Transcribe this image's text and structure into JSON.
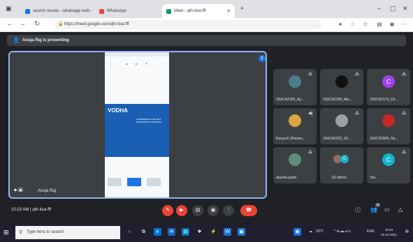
{
  "browser": {
    "tabs": [
      {
        "label": "search results - whatsapp web - ",
        "favicon_color": "#1a73e8"
      },
      {
        "label": "WhatsApp",
        "favicon_color": "#ea4335"
      },
      {
        "label": "Meet - qth-itoa-fff",
        "favicon_color": "#0f9d58"
      }
    ],
    "new_tab": "+",
    "window_controls": {
      "minimize": "–",
      "maximize": "▢",
      "close": "✕"
    },
    "url": "https://meet.google.com/qth-itoa-fff"
  },
  "presenting": {
    "text": "Anuja Raj is presenting"
  },
  "main_video": {
    "name": "Anuja Raj",
    "doc_logo": "VODHA",
    "doc_heading": "EXPERIENCE THE NEXT GENERATION LEARNING"
  },
  "participants": [
    {
      "name": "19UCA2169_Ay...",
      "avatar": "",
      "color": "#4a7c8a"
    },
    {
      "name": "19UCA2196_Ma...",
      "avatar": "",
      "color": "#111111"
    },
    {
      "name": "19UCA2173_Ch...",
      "avatar": "C",
      "color": "#a142f4"
    },
    {
      "name": "Kavya.K (Presen...",
      "avatar": "",
      "color": "#d9a441"
    },
    {
      "name": "19UCA2222_Sh...",
      "avatar": "",
      "color": "#9aa0a6"
    },
    {
      "name": "19UCS2906_Ha...",
      "avatar": "",
      "color": "#c62828"
    },
    {
      "name": "anusha prem",
      "avatar": "",
      "color": "#5f8f7a"
    },
    {
      "name": "63 others",
      "avatar": "C",
      "color": "#12b5cb"
    },
    {
      "name": "You",
      "avatar": "C",
      "color": "#12b5cb"
    }
  ],
  "meeting": {
    "time": "10:23 AM",
    "separator": "|",
    "code": "qth-itoa-fff"
  },
  "people_count": "72",
  "taskbar": {
    "search_placeholder": "Type here to search",
    "weather": "29°C",
    "lang": "ENG",
    "time": "10:23",
    "date": "22-10-2021"
  }
}
